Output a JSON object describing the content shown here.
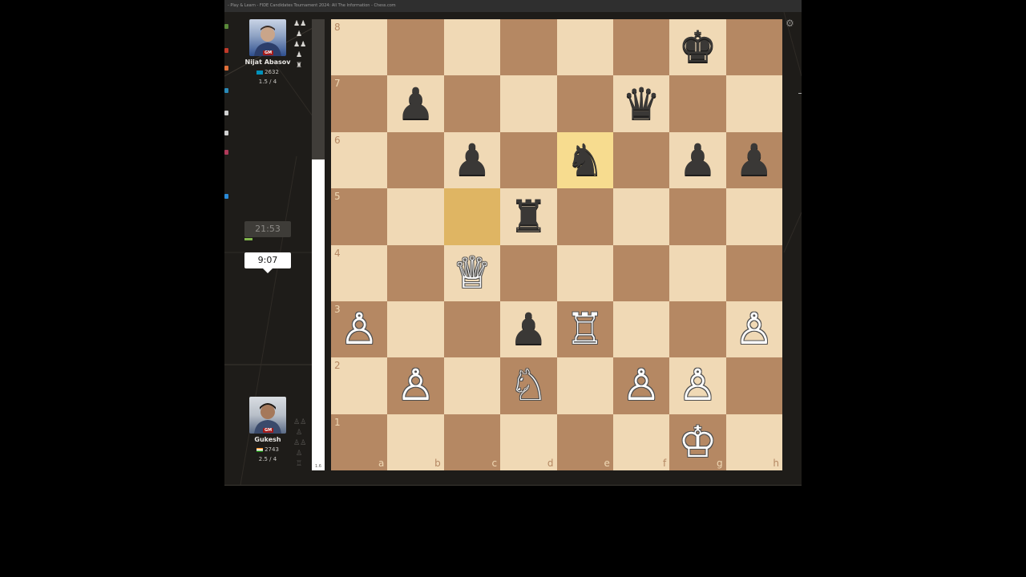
{
  "window": {
    "title": "- Play & Learn - FIDE Candidates Tournament 2024: All The Information - Chess.com"
  },
  "players": {
    "top": {
      "name": "Nijat Abasov",
      "title": "GM",
      "rating": "2632",
      "score": "1.5 / 4",
      "clock": "21:53",
      "flag_color": "#0092bc",
      "captured_icons": [
        "♟♟",
        "♟",
        "♟♟",
        "♟",
        "♜"
      ]
    },
    "bottom": {
      "name": "Gukesh",
      "title": "GM",
      "rating": "2743",
      "score": "2.5 / 4",
      "clock": "9:07",
      "flag_color": "#ff9933",
      "captured_icons": [
        "♙♙",
        "♙",
        "♙♙",
        "♙",
        "♖"
      ]
    }
  },
  "eval_bar": {
    "label": "1.6",
    "white_fraction": 0.69
  },
  "board": {
    "orientation": "white",
    "light_color": "#f0d9b5",
    "dark_color": "#b58863",
    "highlight_squares": [
      "e6",
      "c5"
    ],
    "files": [
      "a",
      "b",
      "c",
      "d",
      "e",
      "f",
      "g",
      "h"
    ],
    "ranks": [
      "8",
      "7",
      "6",
      "5",
      "4",
      "3",
      "2",
      "1"
    ],
    "pieces": {
      "g8": "♚",
      "b7": "♟",
      "f7": "♛",
      "c6": "♟",
      "e6": "♞",
      "g6": "♟",
      "h6": "♟",
      "d5": "♜",
      "c4": "♕",
      "a3": "♙",
      "d3": "♟",
      "e3": "♖",
      "h3": "♙",
      "b2": "♙",
      "d2": "♘",
      "f2": "♙",
      "g2": "♙",
      "g1": "♔"
    },
    "piece_names": {
      "♔": "white-king",
      "♕": "white-queen",
      "♖": "white-rook",
      "♘": "white-knight",
      "♙": "white-pawn",
      "♚": "black-king",
      "♛": "black-queen",
      "♜": "black-rook",
      "♞": "black-knight",
      "♟": "black-pawn"
    }
  },
  "icons": {
    "settings": "gear-icon"
  }
}
